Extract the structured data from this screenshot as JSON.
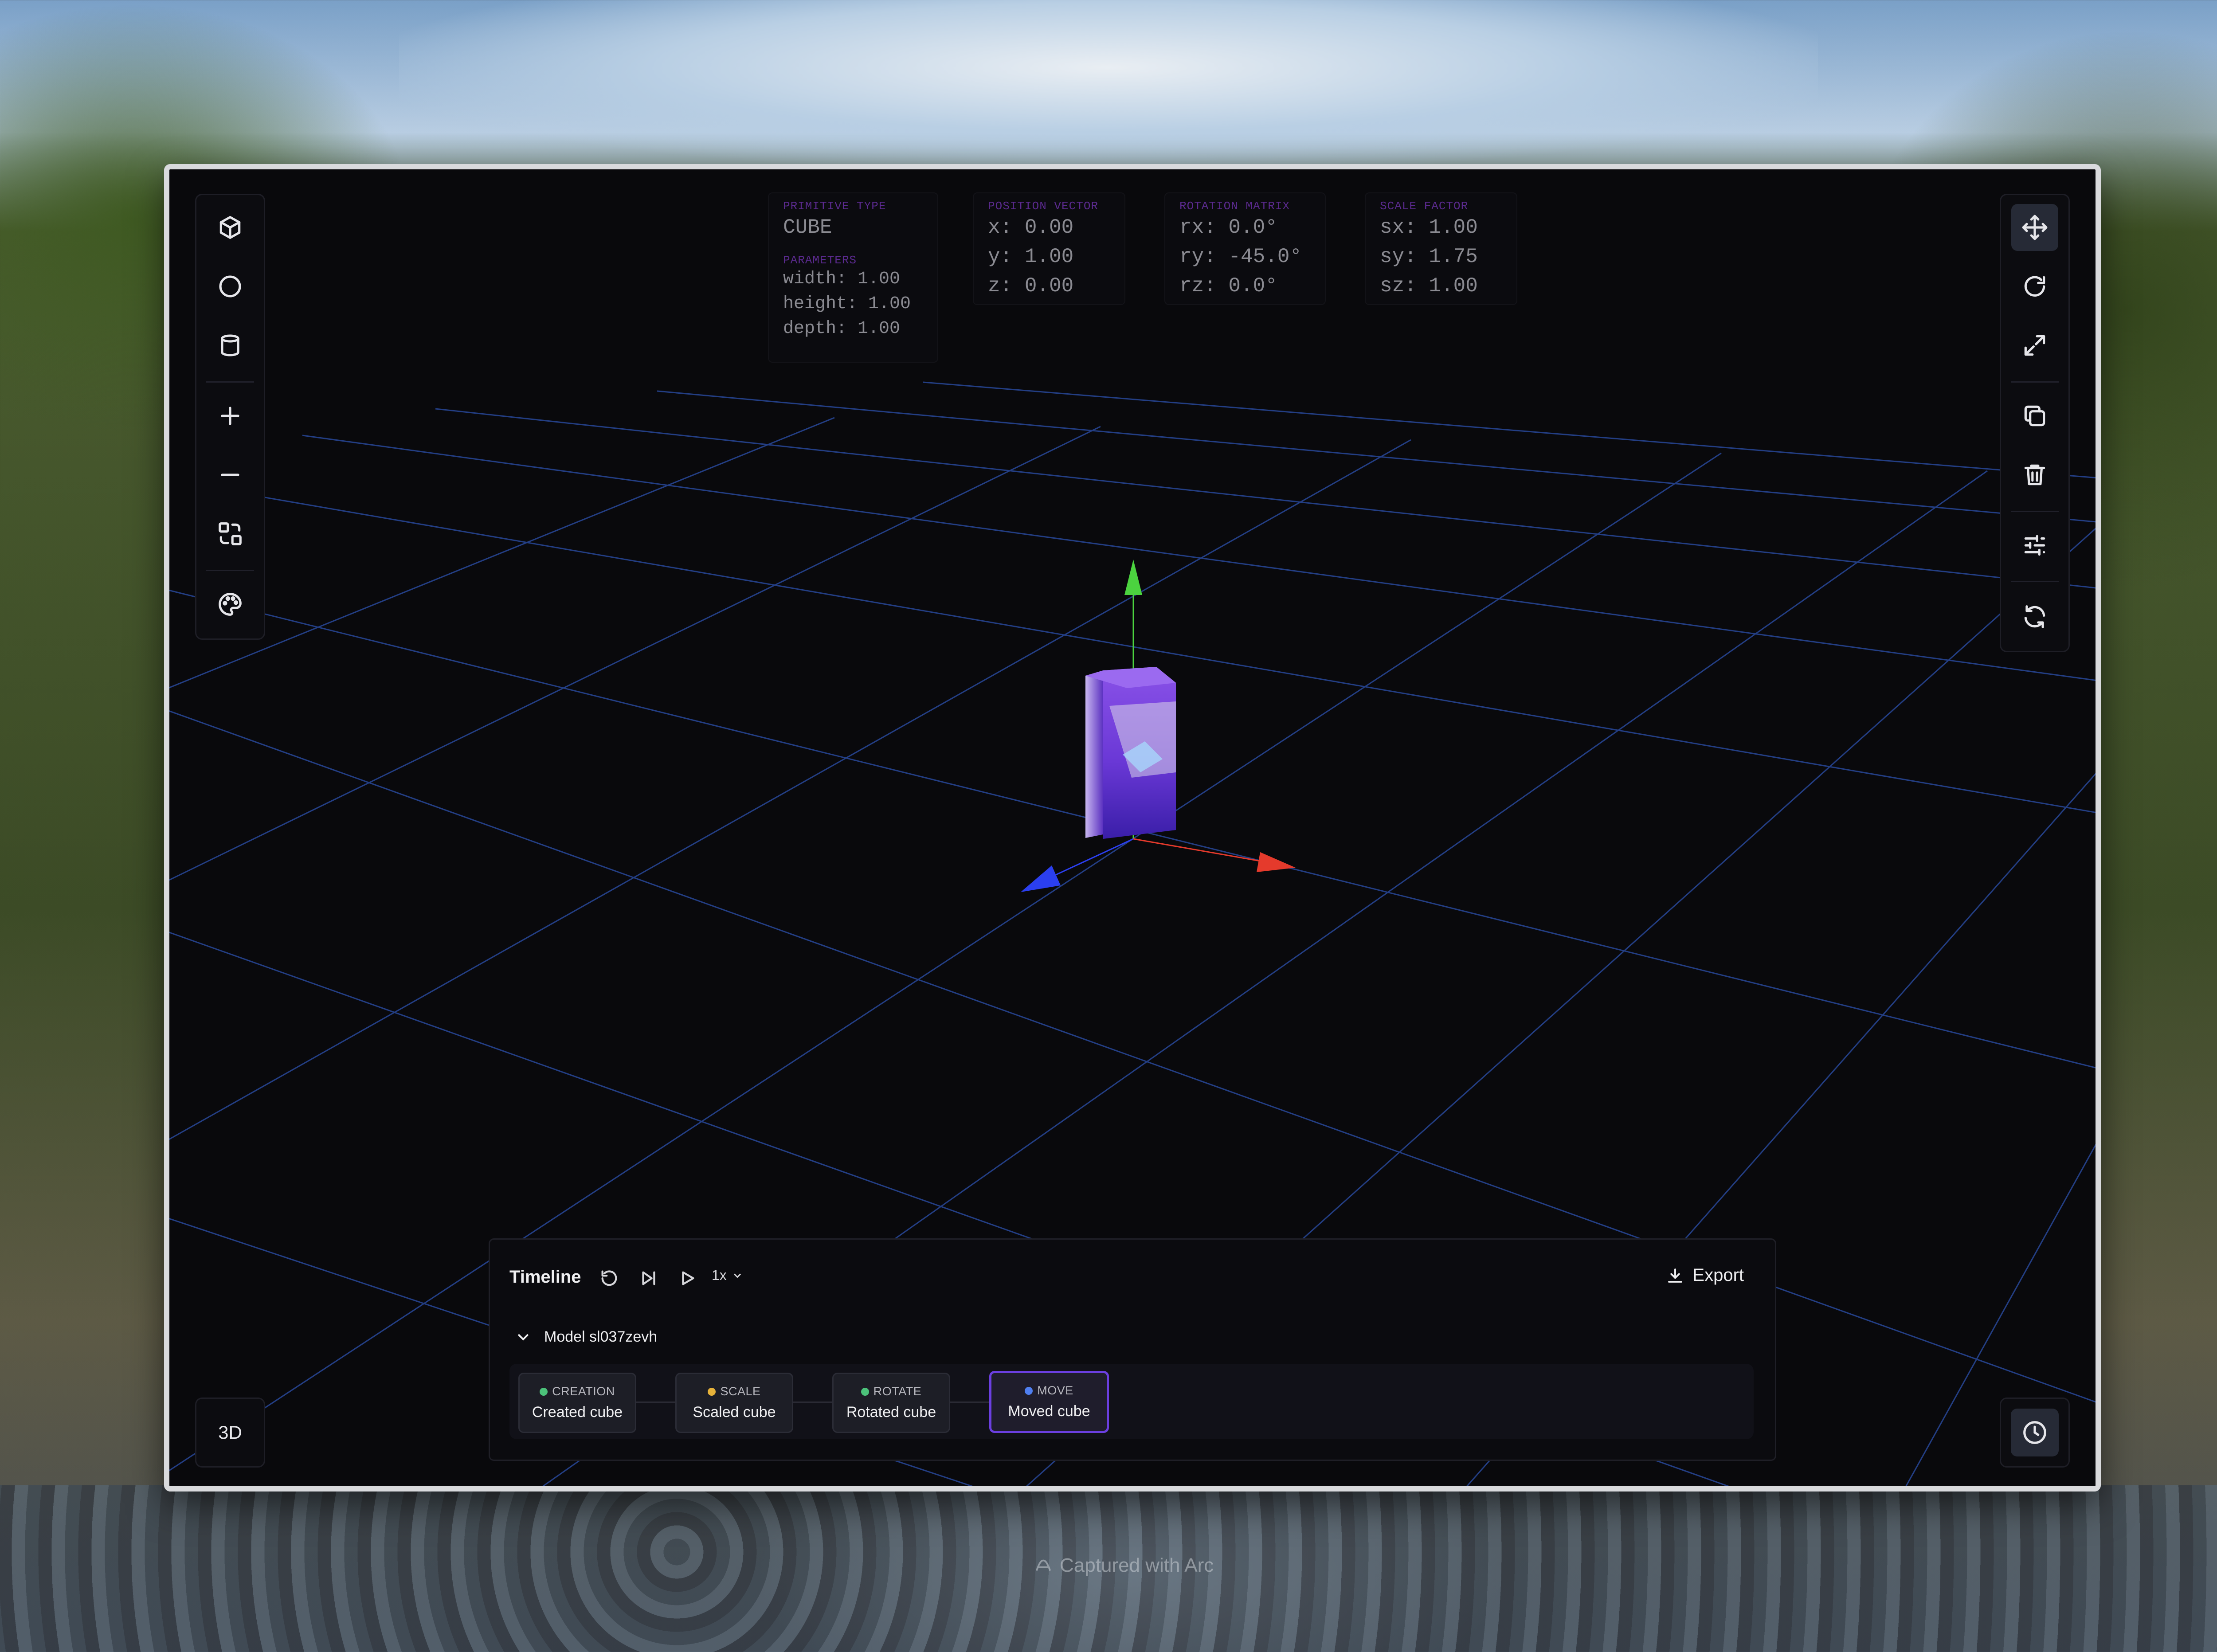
{
  "info": {
    "primitive": {
      "label": "PRIMITIVE TYPE",
      "value": "CUBE"
    },
    "parameters": {
      "label": "PARAMETERS",
      "width": "width: 1.00",
      "height": "height: 1.00",
      "depth": "depth: 1.00"
    },
    "position": {
      "label": "POSITION VECTOR",
      "x": "x: 0.00",
      "y": "y: 1.00",
      "z": "z: 0.00"
    },
    "rotation": {
      "label": "ROTATION MATRIX",
      "rx": "rx: 0.0°",
      "ry": "ry: -45.0°",
      "rz": "rz: 0.0°"
    },
    "scale": {
      "label": "SCALE FACTOR",
      "sx": "sx: 1.00",
      "sy": "sy: 1.75",
      "sz": "sz: 1.00"
    }
  },
  "left_toolbar": {
    "tools": [
      "cube-icon",
      "sphere-icon",
      "cylinder-icon",
      "plus-icon",
      "minus-icon",
      "shapes-swap-icon",
      "palette-icon"
    ]
  },
  "right_toolbar": {
    "tools": [
      "move-icon",
      "rotate-icon",
      "scale-icon",
      "duplicate-icon",
      "trash-icon",
      "sliders-icon",
      "refresh-icon"
    ],
    "active": "move-icon"
  },
  "view_mode": "3D",
  "timeline": {
    "title": "Timeline",
    "speed": "1x",
    "export_label": "Export",
    "model_name": "Model sl037zevh",
    "steps": [
      {
        "tag": "CREATION",
        "name": "Created cube",
        "color": "#4cc27a"
      },
      {
        "tag": "SCALE",
        "name": "Scaled cube",
        "color": "#e6b23a"
      },
      {
        "tag": "ROTATE",
        "name": "Rotated cube",
        "color": "#4cc27a"
      },
      {
        "tag": "MOVE",
        "name": "Moved cube",
        "color": "#4f7ff0"
      }
    ],
    "selected_step": 3
  },
  "colors": {
    "accent": "#6b3fe0",
    "grid": "#2f55b8",
    "axis_x": "#e53a2c",
    "axis_y": "#4bd33f",
    "axis_z": "#2b3ff0"
  },
  "watermark": "Captured with Arc"
}
